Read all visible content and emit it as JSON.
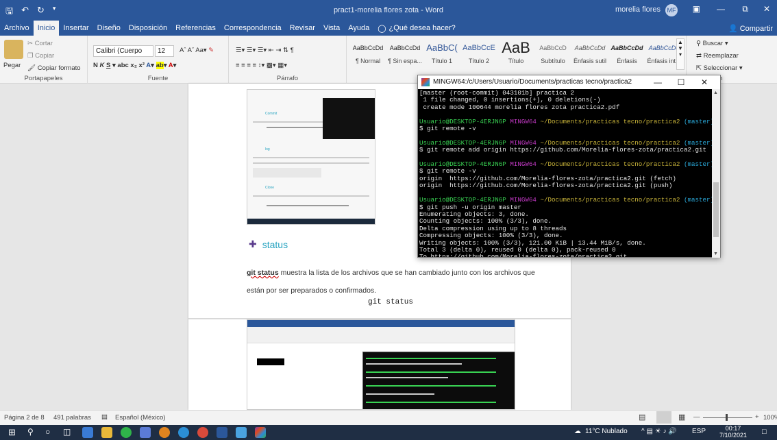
{
  "window": {
    "title": "pract1-morelia flores zota  -  Word",
    "user": "morelia flores",
    "initials": "MF",
    "share": "Compartir"
  },
  "tabs": [
    "Archivo",
    "Inicio",
    "Insertar",
    "Diseño",
    "Disposición",
    "Referencias",
    "Correspondencia",
    "Revisar",
    "Vista",
    "Ayuda"
  ],
  "tellme": "¿Qué desea hacer?",
  "clipboard": {
    "cut": "Cortar",
    "copy": "Copiar",
    "paste": "Pegar",
    "format": "Copiar formato",
    "label": "Portapapeles"
  },
  "font": {
    "name": "Calibri (Cuerpo",
    "size": "12",
    "label": "Fuente"
  },
  "paragraph": {
    "label": "Párrafo"
  },
  "styles": [
    {
      "preview": "AaBbCcDd",
      "name": "¶ Normal"
    },
    {
      "preview": "AaBbCcDd",
      "name": "¶ Sin espa..."
    },
    {
      "preview": "AaBbC(",
      "name": "Título 1"
    },
    {
      "preview": "AaBbCcE",
      "name": "Título 2"
    },
    {
      "preview": "AaB",
      "name": "Título"
    },
    {
      "preview": "AaBbCcD",
      "name": "Subtítulo"
    },
    {
      "preview": "AaBbCcDd",
      "name": "Énfasis sutil"
    },
    {
      "preview": "AaBbCcDd",
      "name": "Énfasis"
    },
    {
      "preview": "AaBbCcDd",
      "name": "Énfasis int..."
    }
  ],
  "editing": {
    "find": "Buscar",
    "replace": "Reemplazar",
    "select": "Seleccionar",
    "label": "ión"
  },
  "document": {
    "inner_items": [
      "Commit",
      "log",
      "Clone"
    ],
    "status_heading": "status",
    "status_text_bold": "git status",
    "status_text_1": " muestra la lista de los archivos que se han cambiado junto con los archivos que",
    "status_text_2": "están por ser preparados o confirmados.",
    "status_code": "git status"
  },
  "terminal": {
    "title": "MINGW64:/c/Users/Usuario/Documents/practicas tecno/practica2",
    "lines": [
      {
        "t": "[master (root-commit) 043101b] practica 2",
        "c": "w"
      },
      {
        "t": " 1 file changed, 0 insertions(+), 0 deletions(-)",
        "c": "w"
      },
      {
        "t": " create mode 100644 morelia flores zota practica2.pdf",
        "c": "w"
      },
      {
        "t": "",
        "c": "w"
      },
      {
        "t": "Usuario@DESKTOP-4ERJN6P MINGW64 ~/Documents/practicas tecno/practica2 (master)",
        "c": "p"
      },
      {
        "t": "$ git remote -v",
        "c": "w"
      },
      {
        "t": "",
        "c": "w"
      },
      {
        "t": "Usuario@DESKTOP-4ERJN6P MINGW64 ~/Documents/practicas tecno/practica2 (master)",
        "c": "p"
      },
      {
        "t": "$ git remote add origin https://github.com/Morelia-flores-zota/practica2.git",
        "c": "w"
      },
      {
        "t": "",
        "c": "w"
      },
      {
        "t": "Usuario@DESKTOP-4ERJN6P MINGW64 ~/Documents/practicas tecno/practica2 (master)",
        "c": "p"
      },
      {
        "t": "$ git remote -v",
        "c": "w"
      },
      {
        "t": "origin  https://github.com/Morelia-flores-zota/practica2.git (fetch)",
        "c": "w"
      },
      {
        "t": "origin  https://github.com/Morelia-flores-zota/practica2.git (push)",
        "c": "w"
      },
      {
        "t": "",
        "c": "w"
      },
      {
        "t": "Usuario@DESKTOP-4ERJN6P MINGW64 ~/Documents/practicas tecno/practica2 (master)",
        "c": "p"
      },
      {
        "t": "$ git push -u origin master",
        "c": "w"
      },
      {
        "t": "Enumerating objects: 3, done.",
        "c": "w"
      },
      {
        "t": "Counting objects: 100% (3/3), done.",
        "c": "w"
      },
      {
        "t": "Delta compression using up to 8 threads",
        "c": "w"
      },
      {
        "t": "Compressing objects: 100% (3/3), done.",
        "c": "w"
      },
      {
        "t": "Writing objects: 100% (3/3), 121.00 KiB | 13.44 MiB/s, done.",
        "c": "w"
      },
      {
        "t": "Total 3 (delta 0), reused 0 (delta 0), pack-reused 0",
        "c": "w"
      },
      {
        "t": "To https://github.com/Morelia-flores-zota/practica2.git",
        "c": "w"
      }
    ]
  },
  "statusbar": {
    "page": "Página 2 de 8",
    "words": "491 palabras",
    "lang": "Español (México)",
    "zoom": "100%"
  },
  "taskbar": {
    "weather": "11°C  Nublado",
    "lang": "ESP",
    "time": "00:17",
    "date": "7/10/2021"
  },
  "colors": {
    "word_blue": "#2b579a",
    "prompt_green": "#39d353",
    "prompt_magenta": "#c239c4",
    "prompt_yellow": "#c9b43a",
    "heading_teal": "#27a3c0"
  }
}
